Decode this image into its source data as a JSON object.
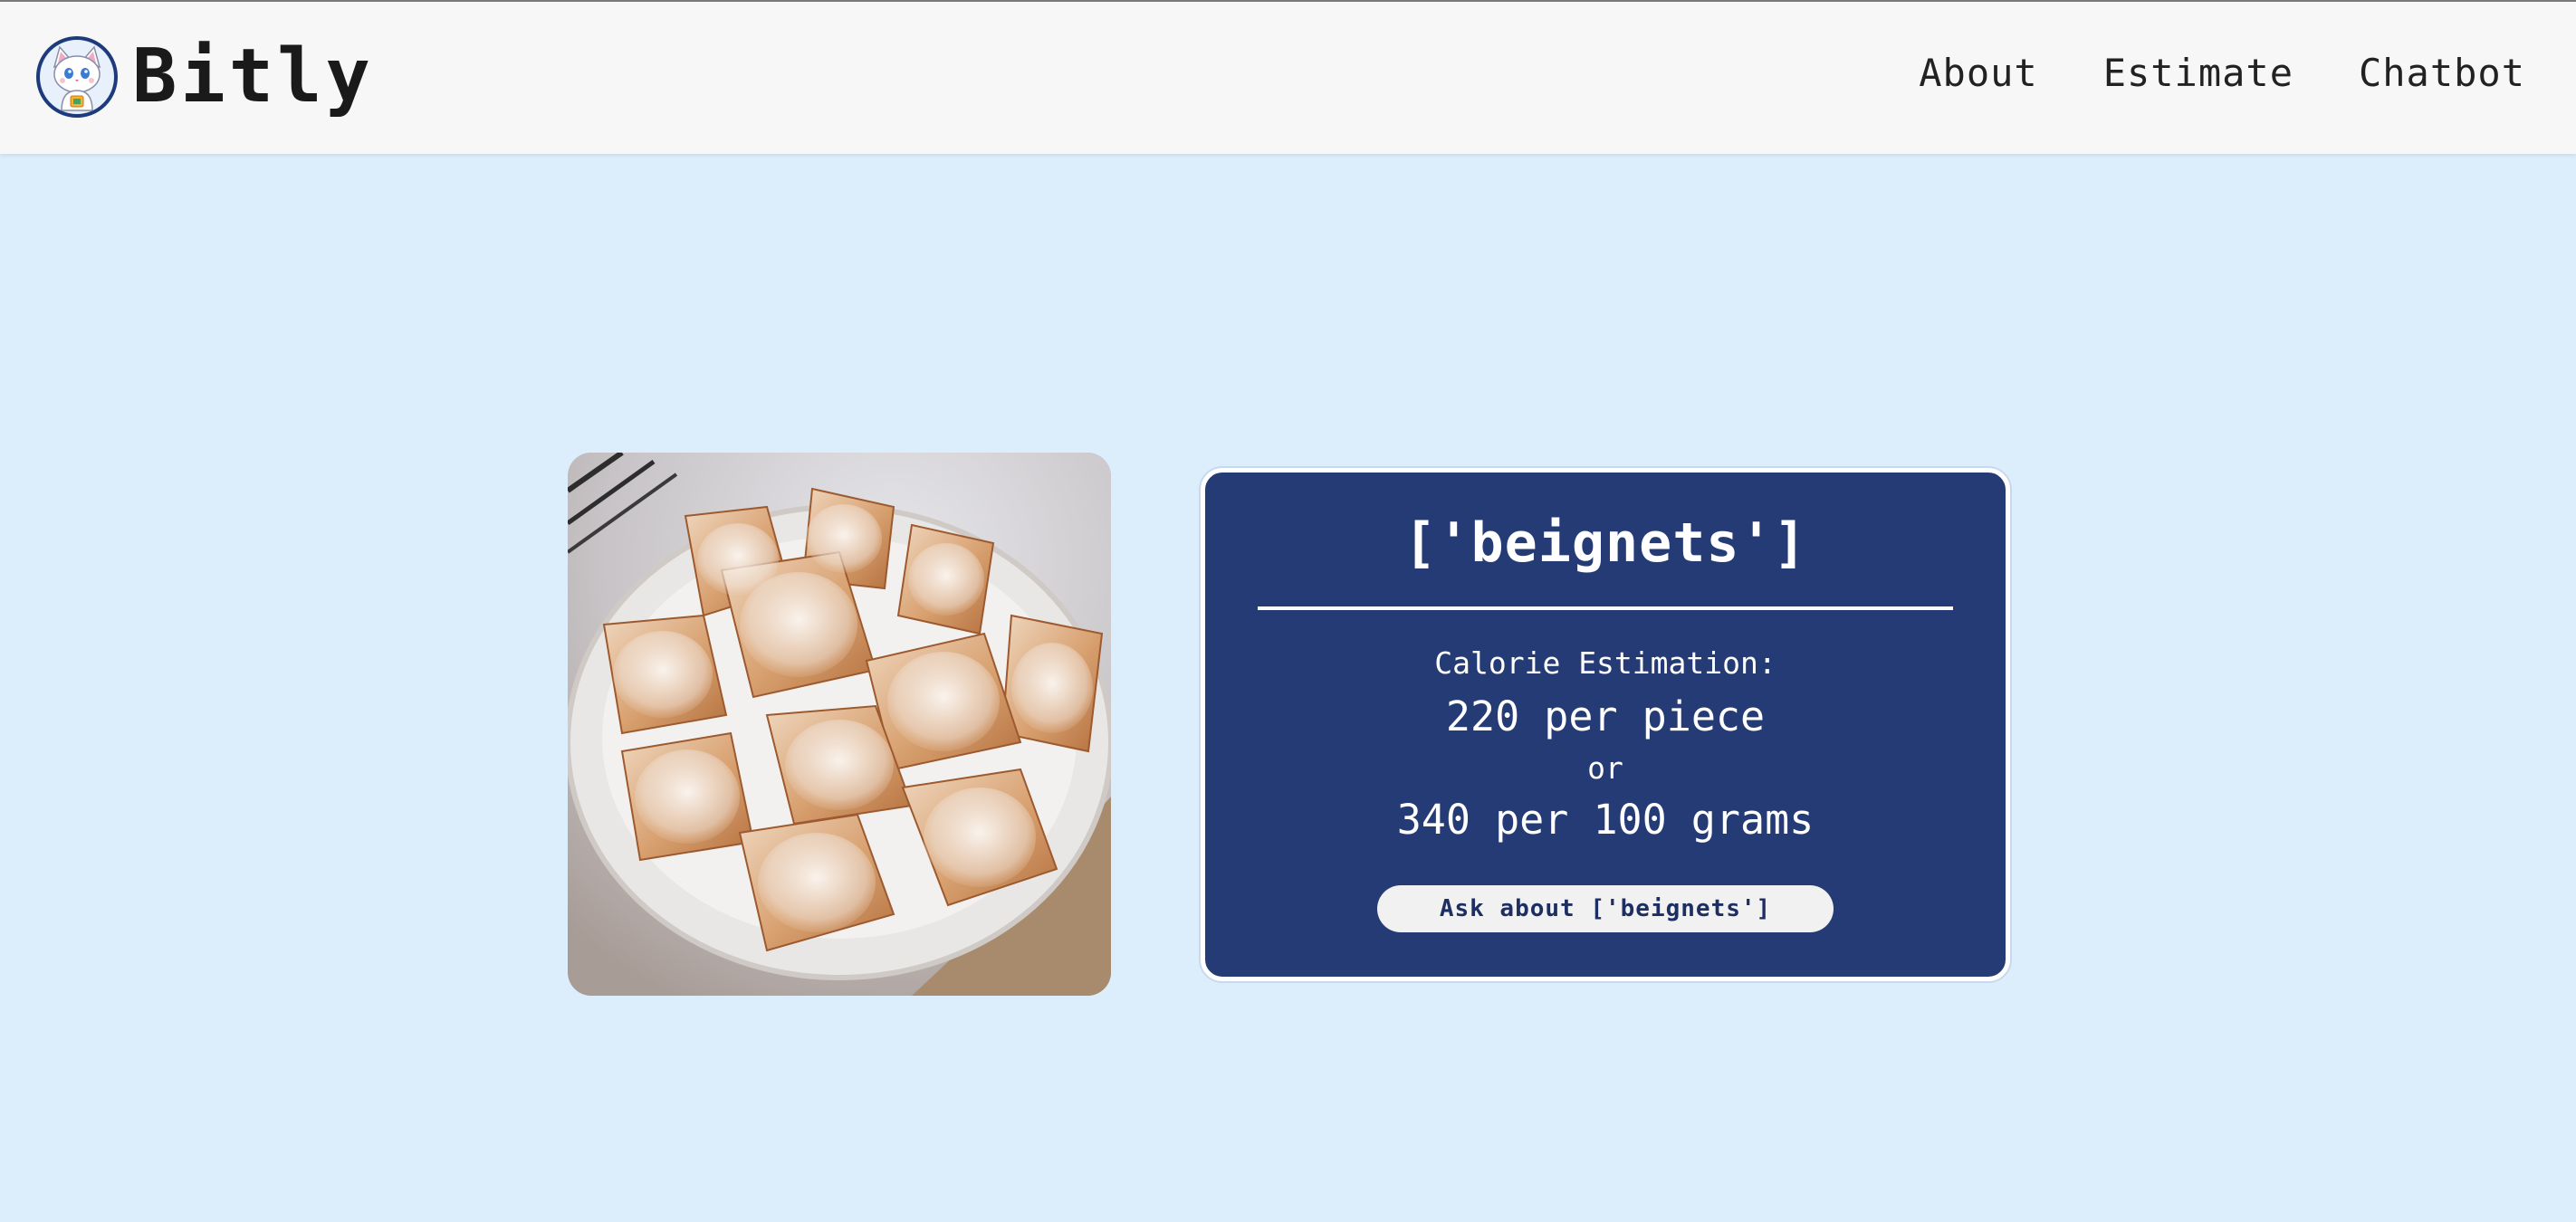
{
  "header": {
    "brand_name": "Bitly",
    "nav": [
      {
        "label": "About"
      },
      {
        "label": "Estimate"
      },
      {
        "label": "Chatbot"
      }
    ]
  },
  "result": {
    "title": "['beignets']",
    "estimation_label": "Calorie Estimation:",
    "per_piece": "220 per piece",
    "or_text": "or",
    "per_100g": "340 per 100 grams",
    "ask_button": "Ask about ['beignets']"
  },
  "colors": {
    "page_background": "#dceefc",
    "header_background": "#f7f7f7",
    "card_background": "#253b75",
    "card_text": "#ffffff",
    "button_background": "#f1f1f1",
    "button_text": "#1d2f62"
  },
  "icons": {
    "logo": "cat-mascot-logo",
    "food_image": "plate-of-beignets-photo"
  }
}
